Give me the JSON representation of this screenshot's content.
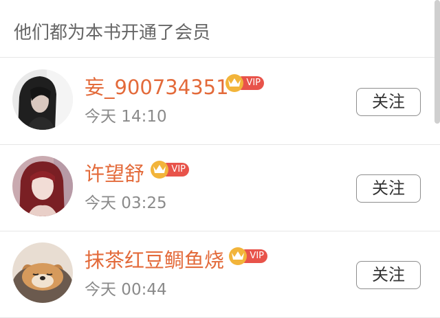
{
  "header": {
    "title": "他们都为本书开通了会员"
  },
  "vip_badge_label": "VIP",
  "members": [
    {
      "avatar_icon": "avatar-dark-hair-woman",
      "name": "妄_900734351",
      "time": "今天 14:10",
      "follow_label": "关注"
    },
    {
      "avatar_icon": "avatar-red-hair-woman",
      "name": "许望舒",
      "time": "今天 03:25",
      "follow_label": "关注"
    },
    {
      "avatar_icon": "avatar-sleeping-dog",
      "name": "抹茶红豆鲷鱼烧",
      "time": "今天 00:44",
      "follow_label": "关注"
    }
  ],
  "colors": {
    "username": "#e36a3a",
    "vip_pill": "#e8534a",
    "crown": "#f2b43a",
    "secondary_text": "#8a8a8a",
    "divider": "#e6e6e6"
  }
}
